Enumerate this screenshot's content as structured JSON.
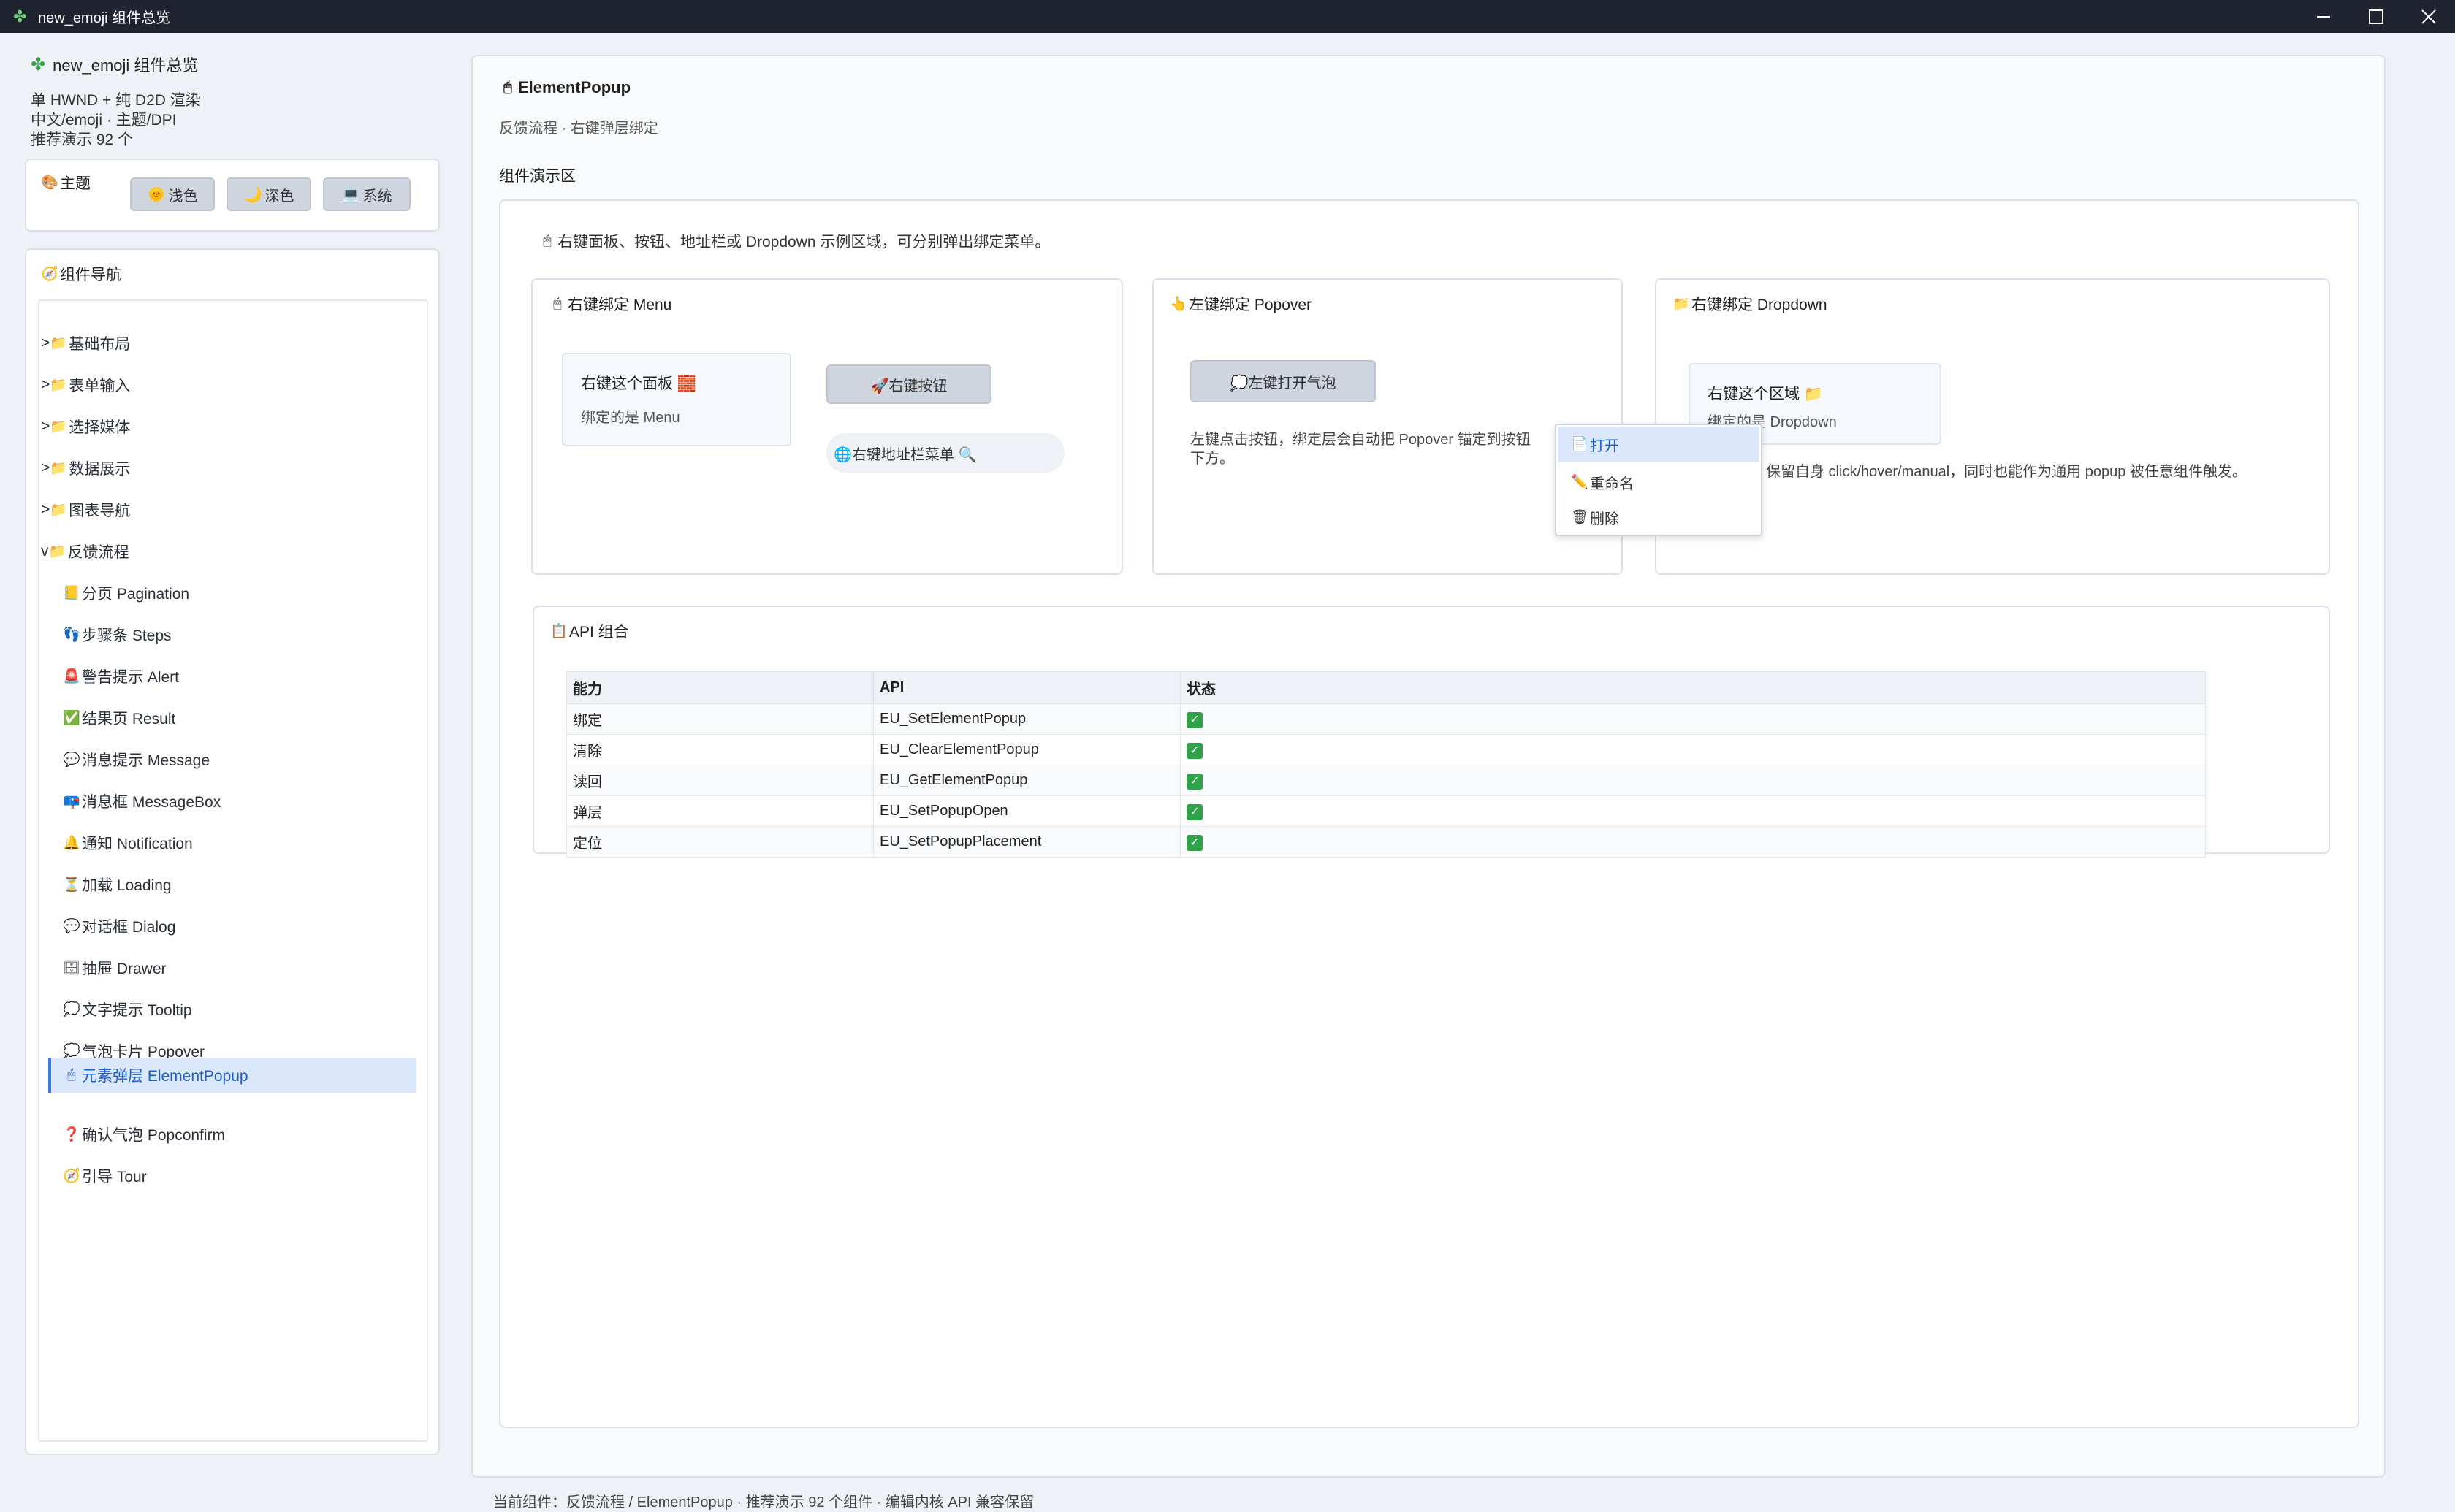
{
  "window": {
    "title": "new_emoji 组件总览"
  },
  "sidebar": {
    "app_title": "new_emoji 组件总览",
    "info_lines": [
      "单 HWND + 纯 D2D 渲染",
      "中文/emoji · 主题/DPI",
      "推荐演示 92 个"
    ],
    "theme": {
      "label": "主题",
      "buttons": [
        {
          "icon": "🌞",
          "label": "浅色"
        },
        {
          "icon": "🌙",
          "label": "深色"
        },
        {
          "icon": "💻",
          "label": "系统"
        }
      ]
    },
    "nav": {
      "label": "组件导航",
      "groups": [
        {
          "prefix": ">",
          "label": "基础布局"
        },
        {
          "prefix": ">",
          "label": "表单输入"
        },
        {
          "prefix": ">",
          "label": "选择媒体"
        },
        {
          "prefix": ">",
          "label": "数据展示"
        },
        {
          "prefix": ">",
          "label": "图表导航"
        },
        {
          "prefix": "v",
          "label": "反馈流程"
        }
      ],
      "items": [
        {
          "icon": "📒",
          "label": "分页 Pagination"
        },
        {
          "icon": "👣",
          "label": "步骤条 Steps"
        },
        {
          "icon": "🚨",
          "label": "警告提示 Alert"
        },
        {
          "icon": "✅",
          "label": "结果页 Result"
        },
        {
          "icon": "💬",
          "label": "消息提示 Message"
        },
        {
          "icon": "📪",
          "label": "消息框 MessageBox"
        },
        {
          "icon": "🔔",
          "label": "通知 Notification"
        },
        {
          "icon": "⏳",
          "label": "加载 Loading"
        },
        {
          "icon": "💬",
          "label": "对话框 Dialog"
        },
        {
          "icon": "🗄",
          "label": "抽屉 Drawer"
        },
        {
          "icon": "💭",
          "label": "文字提示 Tooltip"
        },
        {
          "icon": "💭",
          "label": "气泡卡片 Popover"
        },
        {
          "icon": "🖱",
          "label": "元素弹层 ElementPopup"
        },
        {
          "icon": "❓",
          "label": "确认气泡 Popconfirm"
        },
        {
          "icon": "🧭",
          "label": "引导 Tour"
        }
      ],
      "active_index": 12
    }
  },
  "main": {
    "title": "ElementPopup",
    "subtitle": "反馈流程 · 右键弹层绑定",
    "demo_label": "组件演示区",
    "demo_desc": "右键面板、按钮、地址栏或 Dropdown 示例区域，可分别弹出绑定菜单。",
    "card_menu": {
      "title": "右键绑定 Menu",
      "panel_title": "右键这个面板 🧱",
      "panel_sub": "绑定的是 Menu",
      "button": "🚀右键按钮",
      "address": "🌐右键地址栏菜单 🔍"
    },
    "card_popover": {
      "title": "左键绑定 Popover",
      "button": "💭左键打开气泡",
      "desc_line1": "左键点击按钮，绑定层会自动把 Popover 锚定到按钮",
      "desc_line2": "下方。"
    },
    "card_dropdown": {
      "title": "右键绑定 Dropdown",
      "panel_title": "右键这个区域 📁",
      "panel_sub": "绑定的是 Dropdown",
      "desc": "保留自身 click/hover/manual，同时也能作为通用 popup 被任意组件触发。"
    },
    "context_menu": {
      "items": [
        {
          "icon": "📄",
          "label": "打开"
        },
        {
          "icon": "✏️",
          "label": "重命名"
        },
        {
          "icon": "🗑",
          "label": "删除"
        }
      ]
    },
    "api": {
      "title": "API 组合",
      "columns": [
        "能力",
        "API",
        "状态"
      ],
      "rows": [
        {
          "capability": "绑定",
          "api": "EU_SetElementPopup",
          "status": "✓"
        },
        {
          "capability": "清除",
          "api": "EU_ClearElementPopup",
          "status": "✓"
        },
        {
          "capability": "读回",
          "api": "EU_GetElementPopup",
          "status": "✓"
        },
        {
          "capability": "弹层",
          "api": "EU_SetPopupOpen",
          "status": "✓"
        },
        {
          "capability": "定位",
          "api": "EU_SetPopupPlacement",
          "status": "✓"
        }
      ]
    }
  },
  "status_bar": {
    "text": "当前组件：反馈流程 / ElementPopup · 推荐演示 92 个组件 · 编辑内核 API 兼容保留"
  },
  "colors": {
    "accent": "#3b7be0",
    "titlebar": "#1f2430",
    "active_bg": "#dbe7fb",
    "check": "#2fa24a"
  }
}
